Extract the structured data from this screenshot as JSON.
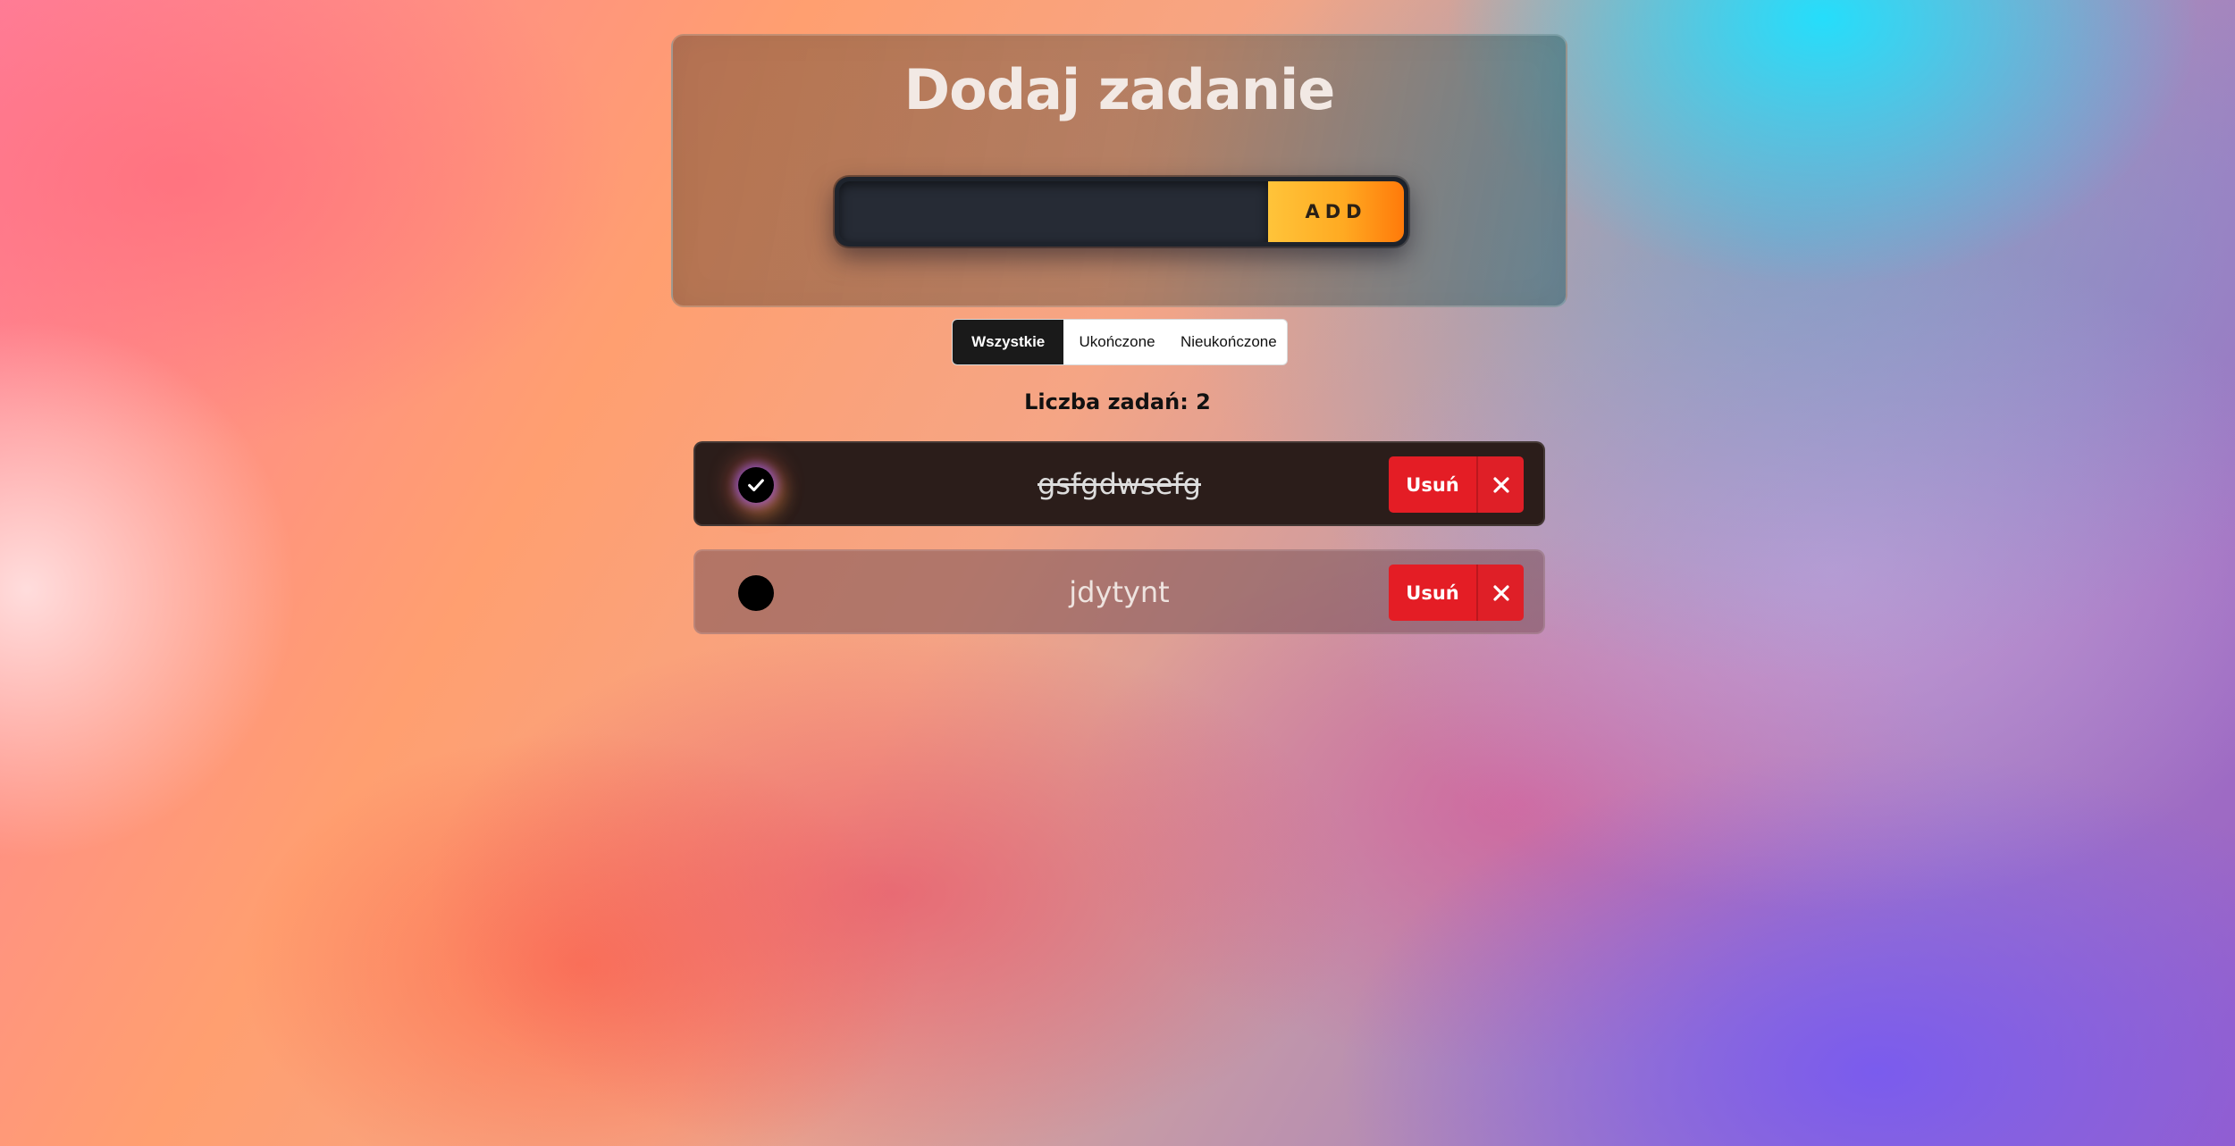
{
  "add_panel": {
    "title": "Dodaj zadanie",
    "input_value": "",
    "input_placeholder": "",
    "add_label": "ADD"
  },
  "filters": {
    "all": "Wszystkie",
    "completed": "Ukończone",
    "uncompleted": "Nieukończone",
    "active": "all"
  },
  "task_count_label": "Liczba zadań: 2",
  "tasks": [
    {
      "text": "gsfgdwsefg",
      "completed": true,
      "delete_label": "Usuń",
      "check_icon": "check-icon",
      "remove_icon": "close-icon"
    },
    {
      "text": "jdytynt",
      "completed": false,
      "delete_label": "Usuń",
      "check_icon": "",
      "remove_icon": "close-icon"
    }
  ],
  "colors": {
    "add_button_start": "#ffc43a",
    "add_button_end": "#ff7a0a",
    "delete_red": "#e41d25",
    "completed_row": "#2b1d1a"
  }
}
